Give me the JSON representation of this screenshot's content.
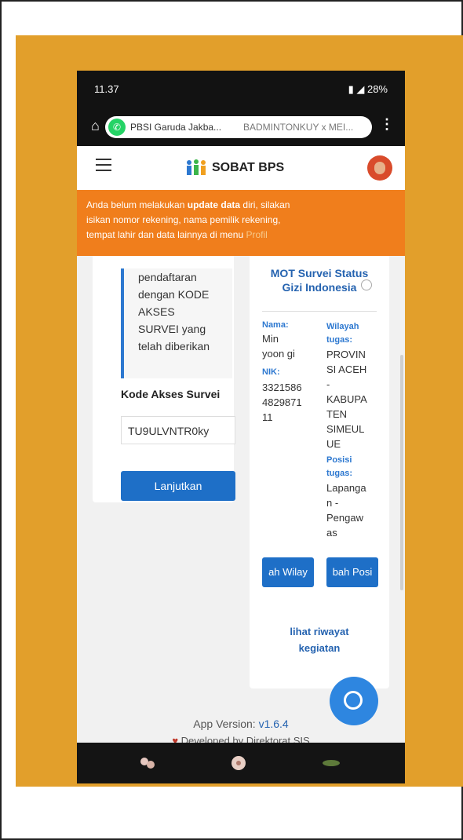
{
  "status_bar": {
    "time": "11.37",
    "battery": "28%"
  },
  "browser": {
    "tab1": "PBSI Garuda Jakba...",
    "tab2": "BADMINTONKUY x MEI..."
  },
  "app_bar": {
    "title": "SOBAT BPS"
  },
  "banner": {
    "line1_pre": "Anda belum melakukan ",
    "line1_bold": "update data",
    "line1_post": " diri, silakan",
    "line2": "isikan nomor rekening, nama pemilik rekening,",
    "line3": "tempat lahir dan data lainnya di menu ",
    "link": "Profil"
  },
  "left_card": {
    "note_lines": [
      "pendaftaran",
      "dengan KODE",
      "AKSES",
      "SURVEI yang",
      "telah diberikan"
    ],
    "kode_label": "Kode Akses Survei",
    "kode_value": "TU9ULVNTR0ky",
    "submit_label": "Lanjutkan"
  },
  "right_card": {
    "survey_title": "MOT Survei Status",
    "survey_sub": "Gizi Indonesia",
    "nama_label": "Nama:",
    "nama_lines": [
      "Min",
      "yoon gi"
    ],
    "nik_label": "NIK:",
    "nik_lines": [
      "3321586",
      "4829871",
      "11"
    ],
    "wilayah_label_lines": [
      "Wilayah",
      "tugas:"
    ],
    "wilayah_lines": [
      "PROVIN",
      "SI ACEH",
      "-",
      "KABUPA",
      "TEN",
      "SIMEUL",
      "UE"
    ],
    "posisi_label_lines": [
      "Posisi",
      "tugas:"
    ],
    "posisi_lines": [
      "Lapanga",
      "n -",
      "Pengaw",
      "as"
    ],
    "btn_wilayah": "ah Wilay",
    "btn_posisi": "bah Posi",
    "riwayat_lines": [
      "lihat riwayat",
      "kegiatan"
    ]
  },
  "footer": {
    "version_label": "App Version: ",
    "version": "v1.6.4",
    "dev_text": "Developed by Direktorat SIS"
  },
  "colors": {
    "background_orange": "#e29f2b",
    "banner_orange": "#f07e1c",
    "primary_blue": "#1e6fc7"
  }
}
